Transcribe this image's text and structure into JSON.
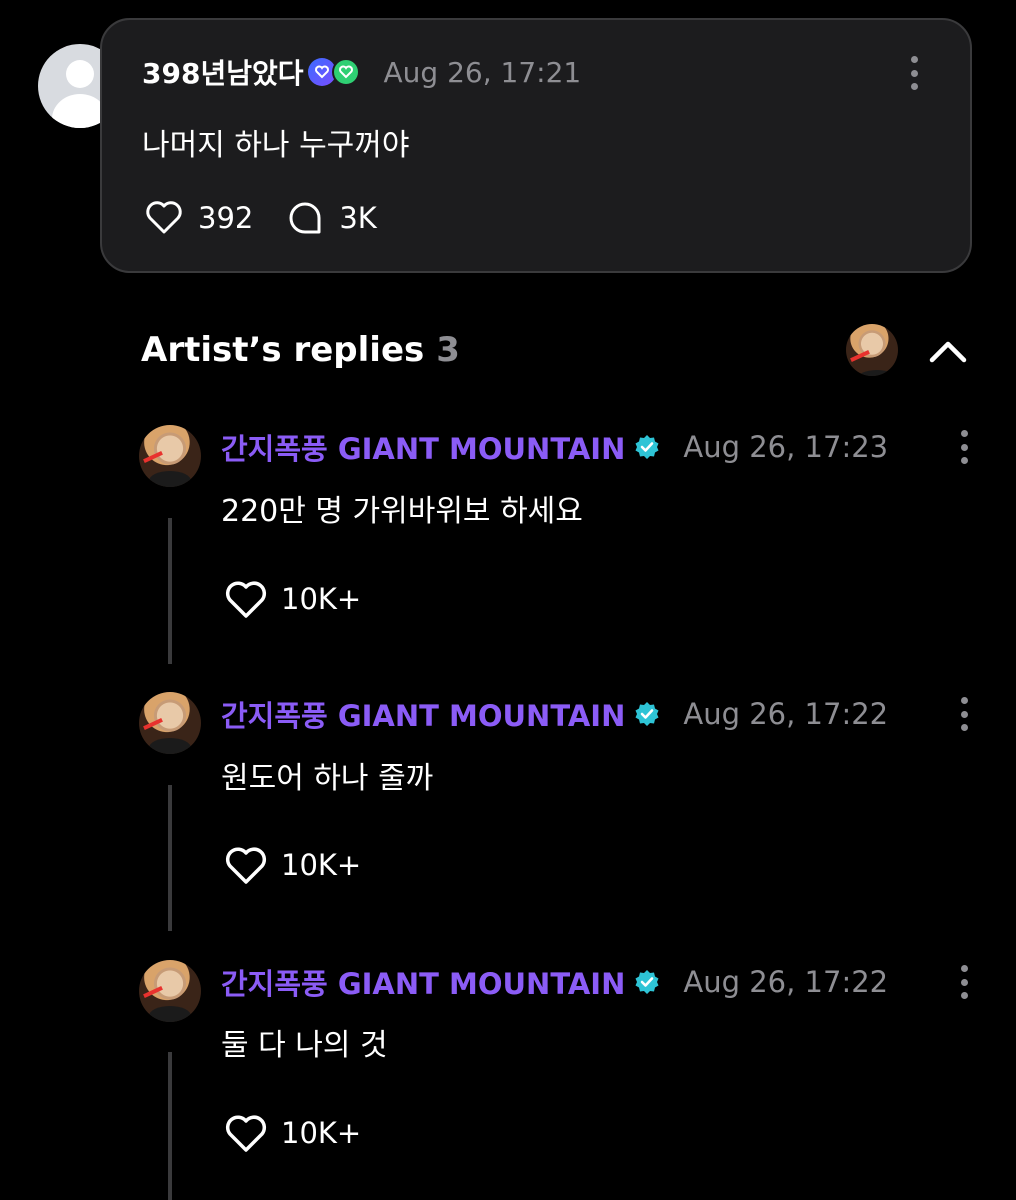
{
  "comment": {
    "username": "398년남았다",
    "timestamp": "Aug 26, 17:21",
    "text": "나머지 하나 누구꺼야",
    "likes": "392",
    "replies": "3K"
  },
  "artist_replies": {
    "title": "Artist’s replies",
    "count": "3",
    "items": [
      {
        "name": "간지폭풍 GIANT MOUNTAIN",
        "timestamp": "Aug 26, 17:23",
        "text": "220만 명 가위바위보 하세요",
        "likes": "10K+"
      },
      {
        "name": "간지폭풍 GIANT MOUNTAIN",
        "timestamp": "Aug 26, 17:22",
        "text": "원도어 하나 줄까",
        "likes": "10K+"
      },
      {
        "name": "간지폭풍 GIANT MOUNTAIN",
        "timestamp": "Aug 26, 17:22",
        "text": "둘 다 나의 것",
        "likes": "10K+"
      }
    ]
  },
  "colors": {
    "background": "#000000",
    "card": "#1c1c1e",
    "artist_name": "#8b5cf6",
    "verified": "#2ec4d6",
    "muted": "#8e8e93"
  },
  "icons": [
    "user-avatar-icon",
    "heart-icon",
    "comment-bubble-icon",
    "more-icon",
    "chevron-up-icon",
    "verified-icon"
  ]
}
